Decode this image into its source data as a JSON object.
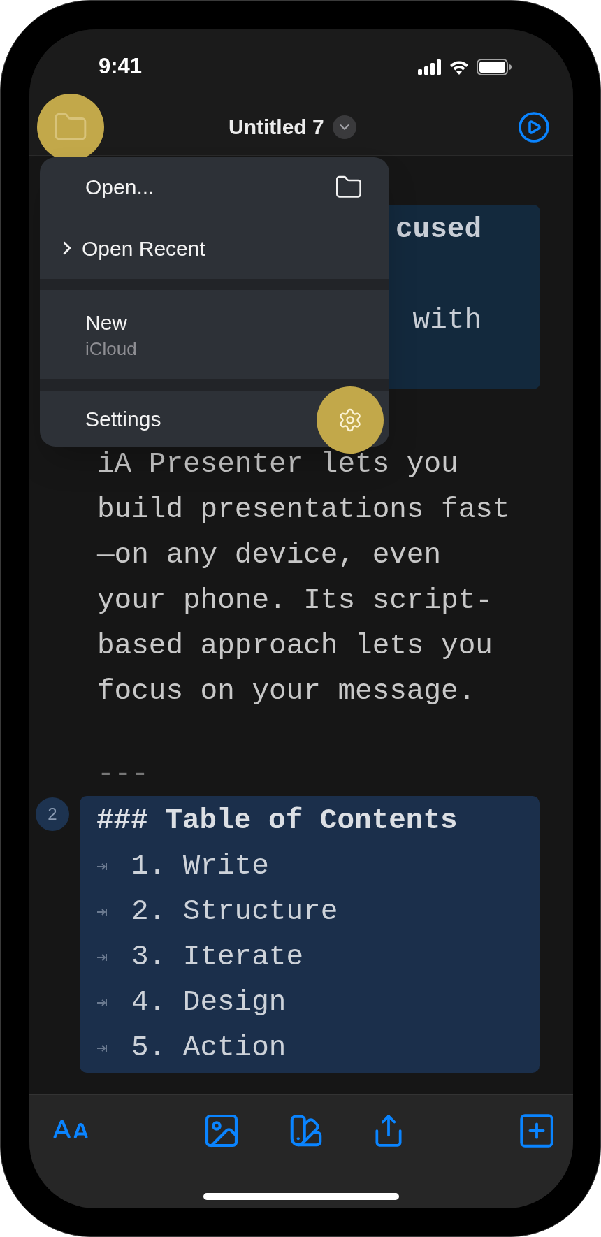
{
  "status_bar": {
    "time": "9:41"
  },
  "nav": {
    "title": "Untitled 7"
  },
  "menu": {
    "groups": [
      [
        {
          "kind": "action",
          "label": "Open..."
        },
        {
          "kind": "submenu",
          "label": "Open Recent"
        }
      ],
      [
        {
          "kind": "subtitle",
          "label": "New",
          "subtitle": "iCloud"
        }
      ],
      [
        {
          "kind": "settings",
          "label": "Settings"
        }
      ]
    ]
  },
  "editor": {
    "items": [
      {
        "kind": "slide_partial",
        "lines": [
          {
            "text": "cused",
            "bold": true
          },
          {
            "text": "with",
            "bold": false
          }
        ]
      },
      {
        "kind": "paragraph",
        "lines": [
          "iA Presenter lets you",
          "build presentations fast",
          "—on any device, even",
          "your phone. Its script-",
          "based approach lets you",
          "focus on your message."
        ]
      },
      {
        "kind": "rule",
        "text": "---"
      },
      {
        "kind": "slide",
        "badge": "2",
        "heading": "### Table of Contents",
        "list": [
          "1. Write",
          "2. Structure",
          "3. Iterate",
          "4. Design",
          "5. Action"
        ]
      }
    ]
  }
}
